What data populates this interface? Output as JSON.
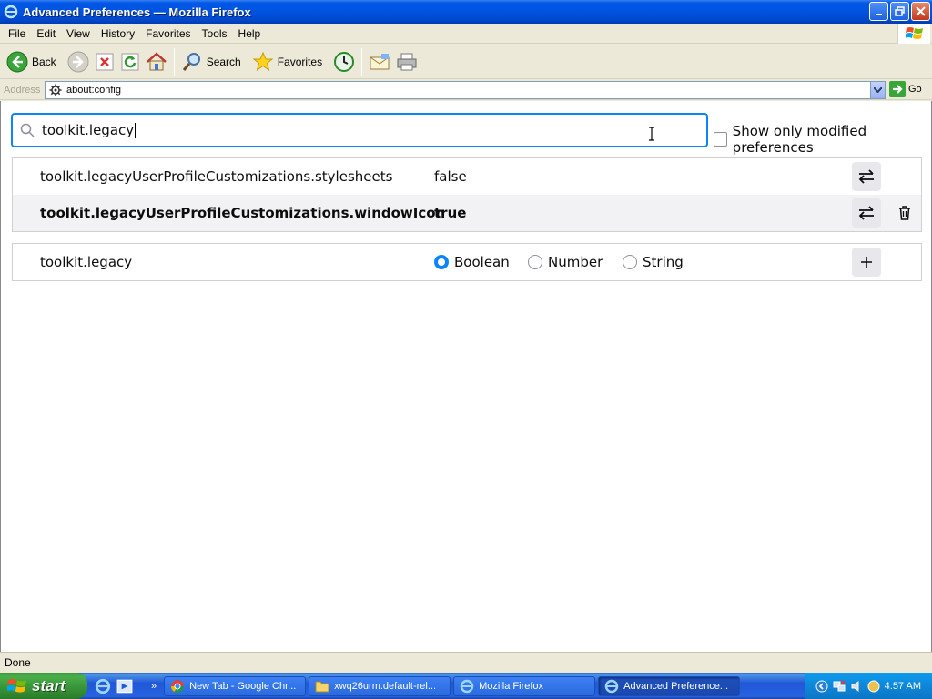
{
  "window": {
    "title": "Advanced Preferences — Mozilla Firefox"
  },
  "menu": [
    "File",
    "Edit",
    "View",
    "History",
    "Favorites",
    "Tools",
    "Help"
  ],
  "toolbar": {
    "back_label": "Back",
    "search_label": "Search",
    "favorites_label": "Favorites"
  },
  "address": {
    "label": "Address",
    "url": "about:config",
    "go_label": "Go"
  },
  "config": {
    "search_value": "toolkit.legacy",
    "show_modified_label": "Show only modified preferences",
    "prefs": [
      {
        "name": "toolkit.legacyUserProfileCustomizations.stylesheets",
        "value": "false"
      },
      {
        "name": "toolkit.legacyUserProfileCustomizations.windowIcon",
        "value": "true"
      }
    ],
    "new_pref": {
      "name": "toolkit.legacy",
      "types": [
        "Boolean",
        "Number",
        "String"
      ],
      "selected": "Boolean"
    }
  },
  "status": {
    "text": "Done"
  },
  "taskbar": {
    "start_label": "start",
    "tasks": [
      "New Tab - Google Chr...",
      "xwq26urm.default-rel...",
      "Mozilla Firefox",
      "Advanced Preference..."
    ],
    "clock": "4:57 AM"
  },
  "colors": {
    "accent": "#0a84ff",
    "titlebar": "#0054e3",
    "taskbar": "#245edb",
    "start": "#3c9a3c"
  }
}
